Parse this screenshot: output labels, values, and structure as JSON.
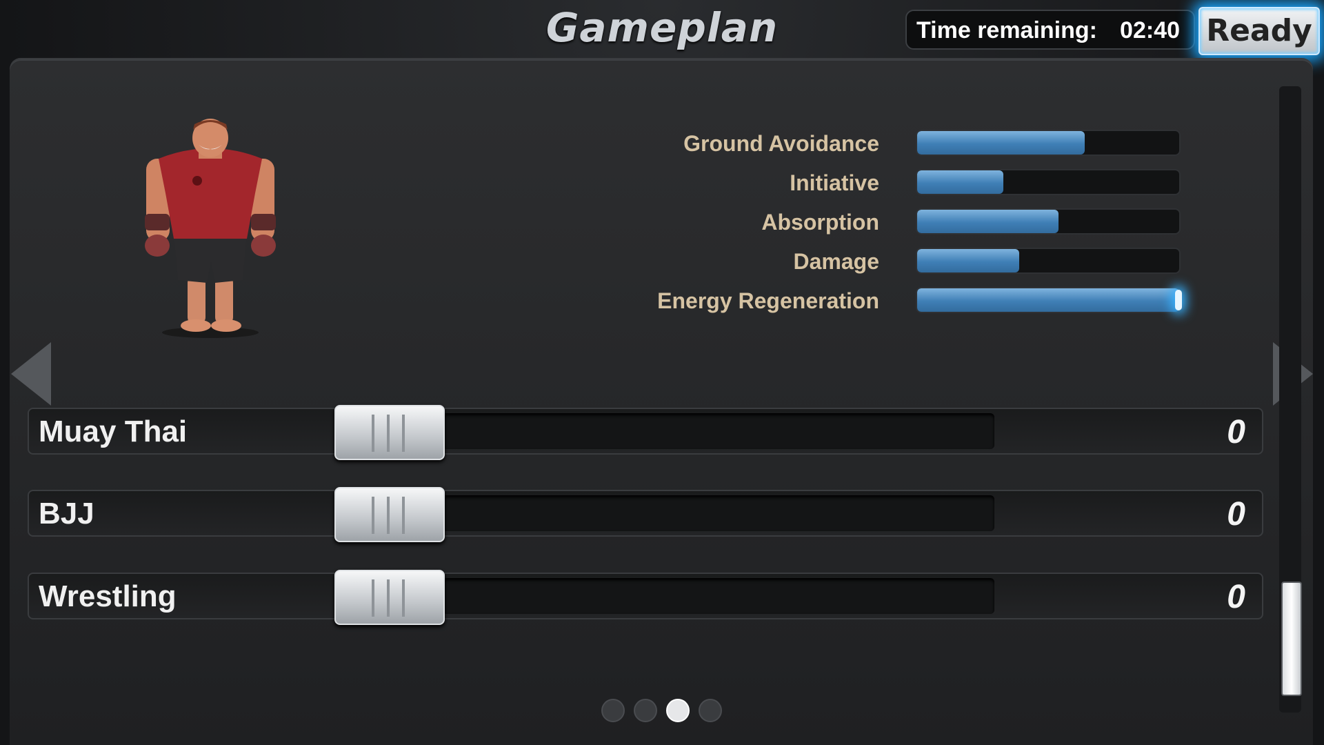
{
  "header": {
    "title": "Gameplan",
    "time_label": "Time remaining:",
    "time_value": "02:40",
    "ready_label": "Ready"
  },
  "stats": [
    {
      "label": "Ground Avoidance",
      "value_percent": 64
    },
    {
      "label": "Initiative",
      "value_percent": 33
    },
    {
      "label": "Absorption",
      "value_percent": 54
    },
    {
      "label": "Damage",
      "value_percent": 39
    },
    {
      "label": "Energy Regeneration",
      "value_percent": 100
    }
  ],
  "disciplines": [
    {
      "name": "Muay Thai",
      "value": "0"
    },
    {
      "name": "BJJ",
      "value": "0"
    },
    {
      "name": "Wrestling",
      "value": "0"
    }
  ],
  "pagination": {
    "total": 4,
    "active_index": 2
  },
  "colors": {
    "stat_label": "#d6c3a3",
    "bar_fill": "#3f7fb6",
    "ready_glow": "#1aa7ff"
  },
  "icons": {
    "prev": "arrow-left-icon",
    "next": "arrow-right-icon"
  }
}
